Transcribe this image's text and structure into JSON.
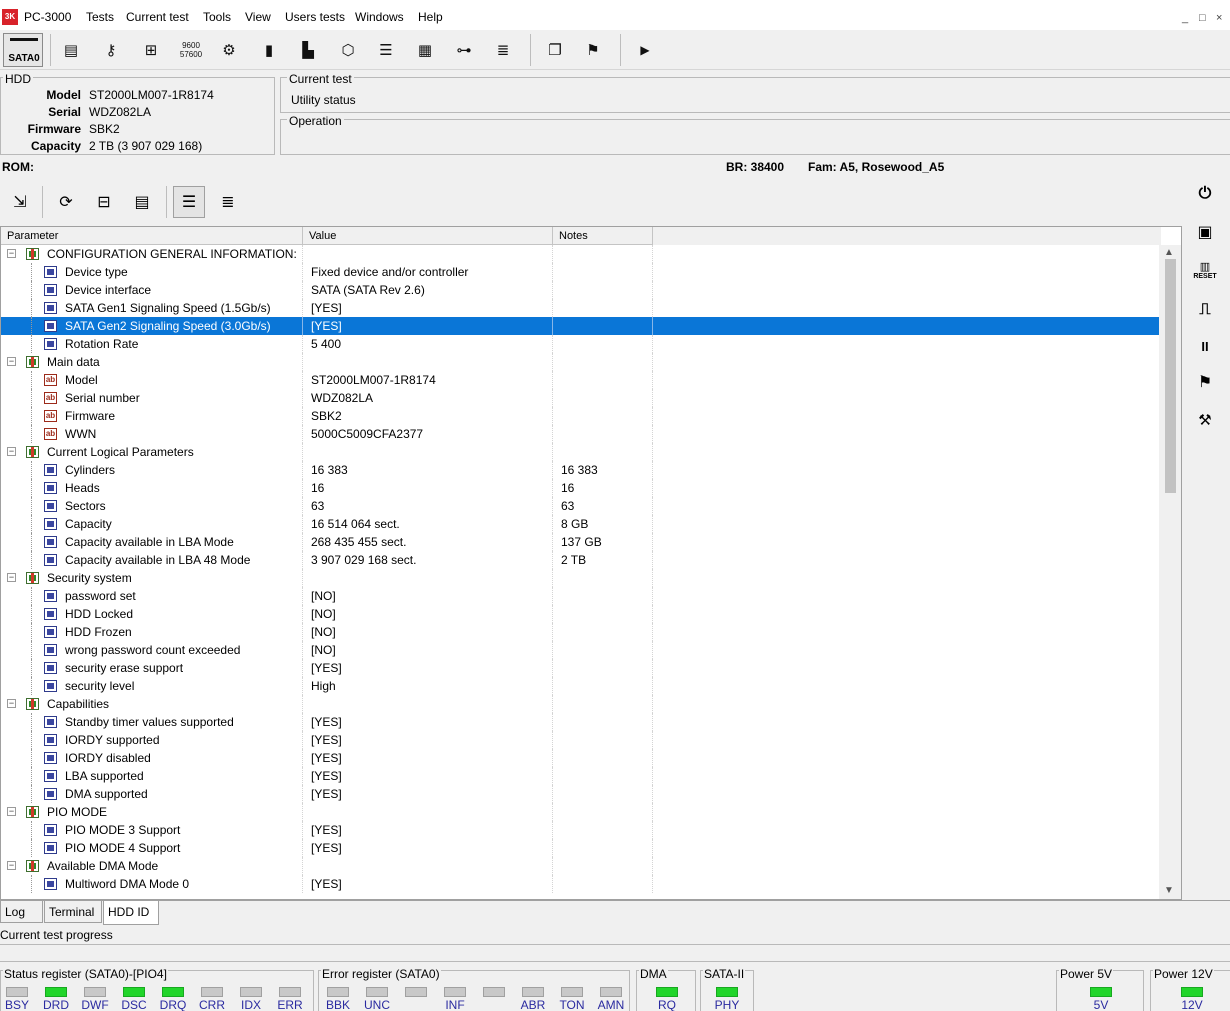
{
  "app": {
    "title": "PC-3000",
    "logo_text": "3K"
  },
  "menu": [
    "PC-3000",
    "Tests",
    "Current test",
    "Tools",
    "View",
    "Users tests",
    "Windows",
    "Help"
  ],
  "window_controls": [
    "_",
    "□",
    "×"
  ],
  "toolbar": {
    "sata_label": "SATA0",
    "icons": [
      "scroll-icon",
      "key-icon",
      "network-icon",
      "baud-icon",
      "gear-cluster-icon",
      "chip-icon",
      "barcode-doc-icon",
      "box-icon",
      "stack-icon",
      "grid-icon",
      "hierarchy-icon",
      "list-icon",
      "copy-icon",
      "person-icon",
      "play-icon"
    ],
    "baud_text": "9600\n57600"
  },
  "hdd": {
    "title": "HDD",
    "model_label": "Model",
    "model": "ST2000LM007-1R8174",
    "serial_label": "Serial",
    "serial": "WDZ082LA",
    "firmware_label": "Firmware",
    "firmware": "SBK2",
    "capacity_label": "Capacity",
    "capacity": "2 TB (3 907 029 168)"
  },
  "current_test": {
    "title": "Current test",
    "value": "Utility status"
  },
  "operation": {
    "title": "Operation"
  },
  "rom_bar": {
    "rom": "ROM:",
    "br": "BR: 38400",
    "fam": "Fam: A5, Rosewood_A5"
  },
  "grid": {
    "headers": [
      "Parameter",
      "Value",
      "Notes"
    ],
    "rows": [
      {
        "level": 0,
        "icon": "chip",
        "name": "CONFIGURATION GENERAL INFORMATION:",
        "value": "",
        "notes": ""
      },
      {
        "level": 1,
        "icon": "grid",
        "name": "Device type",
        "value": "Fixed device and/or controller",
        "notes": ""
      },
      {
        "level": 1,
        "icon": "grid",
        "name": "Device interface",
        "value": "SATA (SATA Rev 2.6)",
        "notes": ""
      },
      {
        "level": 1,
        "icon": "grid",
        "name": "SATA Gen1 Signaling Speed (1.5Gb/s)",
        "value": "[YES]",
        "notes": ""
      },
      {
        "level": 1,
        "icon": "grid",
        "name": "SATA Gen2 Signaling Speed (3.0Gb/s)",
        "value": "[YES]",
        "notes": "",
        "selected": true
      },
      {
        "level": 1,
        "icon": "grid",
        "name": "Rotation Rate",
        "value": "5 400",
        "notes": ""
      },
      {
        "level": 0,
        "icon": "chip",
        "name": "Main data",
        "value": "",
        "notes": ""
      },
      {
        "level": 1,
        "icon": "ab",
        "name": "Model",
        "value": "ST2000LM007-1R8174",
        "notes": ""
      },
      {
        "level": 1,
        "icon": "ab",
        "name": "Serial number",
        "value": "WDZ082LA",
        "notes": ""
      },
      {
        "level": 1,
        "icon": "ab",
        "name": "Firmware",
        "value": "SBK2",
        "notes": ""
      },
      {
        "level": 1,
        "icon": "ab",
        "name": "WWN",
        "value": "5000C5009CFA2377",
        "notes": ""
      },
      {
        "level": 0,
        "icon": "chip",
        "name": "Current Logical Parameters",
        "value": "",
        "notes": ""
      },
      {
        "level": 1,
        "icon": "grid",
        "name": "Cylinders",
        "value": "16 383",
        "notes": "16 383"
      },
      {
        "level": 1,
        "icon": "grid",
        "name": "Heads",
        "value": "16",
        "notes": "16"
      },
      {
        "level": 1,
        "icon": "grid",
        "name": "Sectors",
        "value": "63",
        "notes": "63"
      },
      {
        "level": 1,
        "icon": "grid",
        "name": "Capacity",
        "value": "16 514 064 sect.",
        "notes": "8 GB"
      },
      {
        "level": 1,
        "icon": "grid",
        "name": "Capacity available in LBA Mode",
        "value": "268 435 455 sect.",
        "notes": "137 GB"
      },
      {
        "level": 1,
        "icon": "grid",
        "name": "Capacity available in LBA 48 Mode",
        "value": "3 907 029 168 sect.",
        "notes": "2 TB"
      },
      {
        "level": 0,
        "icon": "chip",
        "name": "Security system",
        "value": "",
        "notes": ""
      },
      {
        "level": 1,
        "icon": "grid",
        "name": "password set",
        "value": "[NO]",
        "notes": ""
      },
      {
        "level": 1,
        "icon": "grid",
        "name": "HDD Locked",
        "value": "[NO]",
        "notes": ""
      },
      {
        "level": 1,
        "icon": "grid",
        "name": "HDD Frozen",
        "value": "[NO]",
        "notes": ""
      },
      {
        "level": 1,
        "icon": "grid",
        "name": "wrong password count exceeded",
        "value": "[NO]",
        "notes": ""
      },
      {
        "level": 1,
        "icon": "grid",
        "name": "security erase support",
        "value": "[YES]",
        "notes": ""
      },
      {
        "level": 1,
        "icon": "grid",
        "name": "security level",
        "value": "High",
        "notes": ""
      },
      {
        "level": 0,
        "icon": "chip",
        "name": "Capabilities",
        "value": "",
        "notes": ""
      },
      {
        "level": 1,
        "icon": "grid",
        "name": "Standby timer values supported",
        "value": "[YES]",
        "notes": ""
      },
      {
        "level": 1,
        "icon": "grid",
        "name": "IORDY supported",
        "value": "[YES]",
        "notes": ""
      },
      {
        "level": 1,
        "icon": "grid",
        "name": "IORDY disabled",
        "value": "[YES]",
        "notes": ""
      },
      {
        "level": 1,
        "icon": "grid",
        "name": "LBA supported",
        "value": "[YES]",
        "notes": ""
      },
      {
        "level": 1,
        "icon": "grid",
        "name": "DMA supported",
        "value": "[YES]",
        "notes": ""
      },
      {
        "level": 0,
        "icon": "chip",
        "name": "PIO MODE",
        "value": "",
        "notes": ""
      },
      {
        "level": 1,
        "icon": "grid",
        "name": "PIO MODE 3 Support",
        "value": "[YES]",
        "notes": ""
      },
      {
        "level": 1,
        "icon": "grid",
        "name": "PIO MODE 4 Support",
        "value": "[YES]",
        "notes": ""
      },
      {
        "level": 0,
        "icon": "chip",
        "name": "Available DMA Mode",
        "value": "",
        "notes": ""
      },
      {
        "level": 1,
        "icon": "grid",
        "name": "Multiword DMA Mode 0",
        "value": "[YES]",
        "notes": ""
      }
    ]
  },
  "right_bar": [
    "power-icon",
    "board-icon",
    "reset-icon",
    "signal-icon",
    "pause-icon",
    "flag-icon",
    "tools-icon"
  ],
  "right_bar_text": {
    "reset": "RESET",
    "pause": "II"
  },
  "tabs": [
    "Log",
    "Terminal",
    "HDD ID"
  ],
  "progress": {
    "label": "Current test progress"
  },
  "status": {
    "status_reg": {
      "title": "Status register (SATA0)-[PIO4]",
      "leds": [
        {
          "label": "BSY",
          "on": false
        },
        {
          "label": "DRD",
          "on": true
        },
        {
          "label": "DWF",
          "on": false
        },
        {
          "label": "DSC",
          "on": true
        },
        {
          "label": "DRQ",
          "on": true
        },
        {
          "label": "CRR",
          "on": false
        },
        {
          "label": "IDX",
          "on": false
        },
        {
          "label": "ERR",
          "on": false
        }
      ]
    },
    "error_reg": {
      "title": "Error register (SATA0)",
      "leds": [
        {
          "label": "BBK",
          "on": false
        },
        {
          "label": "UNC",
          "on": false
        },
        {
          "label": "",
          "on": false
        },
        {
          "label": "INF",
          "on": false
        },
        {
          "label": "",
          "on": false
        },
        {
          "label": "ABR",
          "on": false
        },
        {
          "label": "TON",
          "on": false
        },
        {
          "label": "AMN",
          "on": false
        }
      ]
    },
    "dma": {
      "title": "DMA",
      "leds": [
        {
          "label": "RQ",
          "on": true
        }
      ]
    },
    "sata2": {
      "title": "SATA-II",
      "leds": [
        {
          "label": "PHY",
          "on": true
        }
      ]
    },
    "power5": {
      "title": "Power 5V",
      "leds": [
        {
          "label": "5V",
          "on": true
        }
      ]
    },
    "power12": {
      "title": "Power 12V",
      "leds": [
        {
          "label": "12V",
          "on": true
        }
      ]
    }
  }
}
